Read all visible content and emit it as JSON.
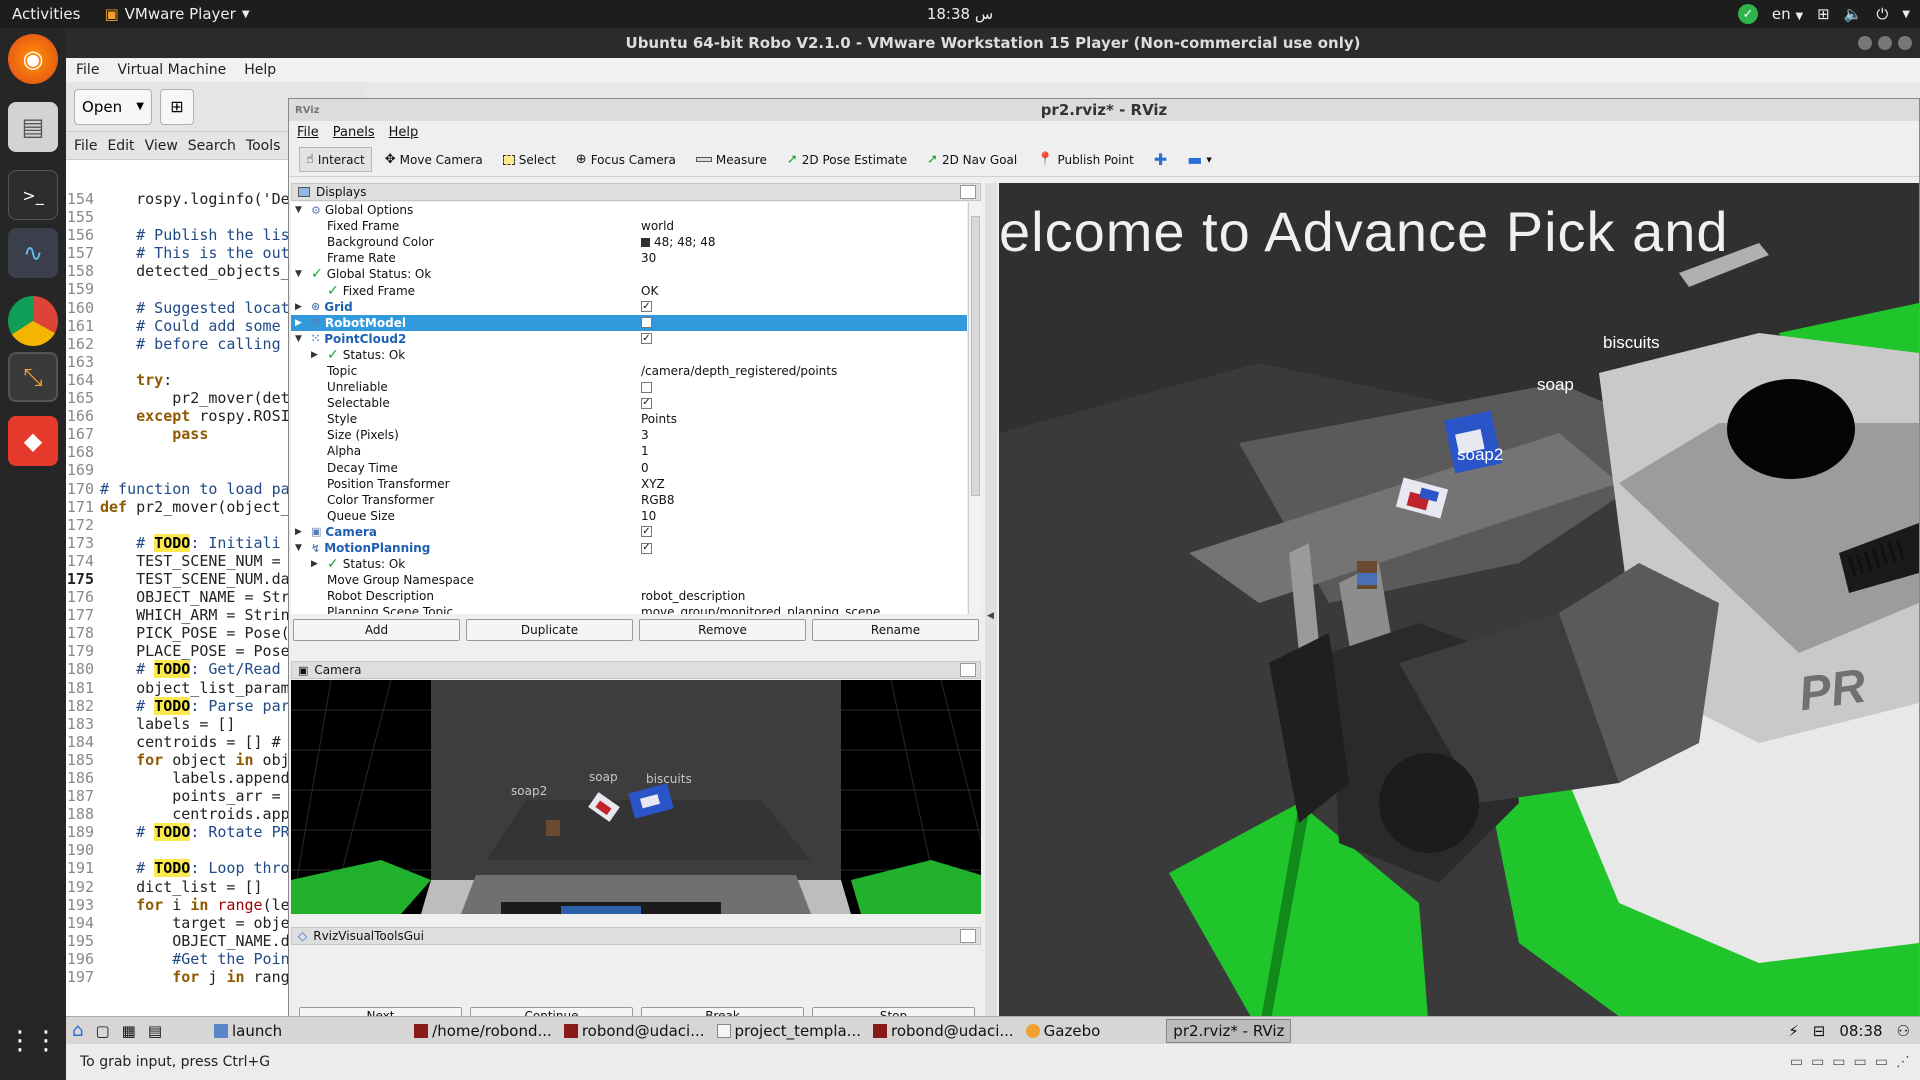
{
  "topbar": {
    "activities": "Activities",
    "app_name": "VMware Player",
    "clock": "18:38 س",
    "lang": "en"
  },
  "vmware": {
    "title": "Ubuntu 64-bit Robo V2.1.0 - VMware Workstation 15 Player (Non-commercial use only)",
    "menu": [
      "File",
      "Virtual Machine",
      "Help"
    ],
    "status": "To grab input, press Ctrl+G"
  },
  "gedit": {
    "open_label": "Open",
    "menu": [
      "File",
      "Edit",
      "View",
      "Search",
      "Tools"
    ],
    "lines": [
      {
        "n": "154",
        "t": "    rospy.loginfo('De"
      },
      {
        "n": "155",
        "t": ""
      },
      {
        "n": "156",
        "t": "    # Publish the lis"
      },
      {
        "n": "157",
        "t": "    # This is the out"
      },
      {
        "n": "158",
        "t": "    detected_objects_"
      },
      {
        "n": "159",
        "t": ""
      },
      {
        "n": "160",
        "t": "    # Suggested locat"
      },
      {
        "n": "161",
        "t": "    # Could add some"
      },
      {
        "n": "162",
        "t": "    # before calling"
      },
      {
        "n": "163",
        "t": ""
      },
      {
        "n": "164",
        "t": "    try:"
      },
      {
        "n": "165",
        "t": "        pr2_mover(det"
      },
      {
        "n": "166",
        "t": "    except rospy.ROSI"
      },
      {
        "n": "167",
        "t": "        pass"
      },
      {
        "n": "168",
        "t": ""
      },
      {
        "n": "169",
        "t": ""
      },
      {
        "n": "170",
        "t": "# function to load pa"
      },
      {
        "n": "171",
        "t": "def pr2_mover(object_"
      },
      {
        "n": "172",
        "t": ""
      },
      {
        "n": "173",
        "t": "    # TODO: Initiali"
      },
      {
        "n": "174",
        "t": "    TEST_SCENE_NUM ="
      },
      {
        "n": "175",
        "t": "    TEST_SCENE_NUM.da"
      },
      {
        "n": "176",
        "t": "    OBJECT_NAME = Str"
      },
      {
        "n": "177",
        "t": "    WHICH_ARM = Strin"
      },
      {
        "n": "178",
        "t": "    PICK_POSE = Pose("
      },
      {
        "n": "179",
        "t": "    PLACE_POSE = Pose"
      },
      {
        "n": "180",
        "t": "    # TODO: Get/Read"
      },
      {
        "n": "181",
        "t": "    object_list_param"
      },
      {
        "n": "182",
        "t": "    # TODO: Parse par"
      },
      {
        "n": "183",
        "t": "    labels = []"
      },
      {
        "n": "184",
        "t": "    centroids = [] #"
      },
      {
        "n": "185",
        "t": "    for object in obj"
      },
      {
        "n": "186",
        "t": "        labels.append"
      },
      {
        "n": "187",
        "t": "        points_arr ="
      },
      {
        "n": "188",
        "t": "        centroids.app"
      },
      {
        "n": "189",
        "t": "    # TODO: Rotate PR"
      },
      {
        "n": "190",
        "t": ""
      },
      {
        "n": "191",
        "t": "    # TODO: Loop thro"
      },
      {
        "n": "192",
        "t": "    dict_list = []"
      },
      {
        "n": "193",
        "t": "    for i in range(le"
      },
      {
        "n": "194",
        "t": "        target = obje"
      },
      {
        "n": "195",
        "t": "        OBJECT_NAME.d"
      },
      {
        "n": "196",
        "t": "        #Get the Poin"
      },
      {
        "n": "197",
        "t": "        for j in rang"
      }
    ]
  },
  "rviz": {
    "title": "pr2.rviz* - RViz",
    "menu": [
      "File",
      "Panels",
      "Help"
    ],
    "tools": [
      {
        "label": "Interact",
        "icon": "cursor-icon"
      },
      {
        "label": "Move Camera",
        "icon": "move-camera-icon"
      },
      {
        "label": "Select",
        "icon": "select-icon"
      },
      {
        "label": "Focus Camera",
        "icon": "focus-icon"
      },
      {
        "label": "Measure",
        "icon": "ruler-icon"
      },
      {
        "label": "2D Pose Estimate",
        "icon": "green-arrow-icon"
      },
      {
        "label": "2D Nav Goal",
        "icon": "green-arrow-icon"
      },
      {
        "label": "Publish Point",
        "icon": "pin-icon"
      }
    ],
    "displays_title": "Displays",
    "tree": [
      {
        "label": "Global Options",
        "value": ""
      },
      {
        "label": "Fixed Frame",
        "value": "world"
      },
      {
        "label": "Background Color",
        "value": "48; 48; 48"
      },
      {
        "label": "Frame Rate",
        "value": "30"
      },
      {
        "label": "Global Status: Ok",
        "value": ""
      },
      {
        "label": "Fixed Frame",
        "value": "OK"
      },
      {
        "label": "Grid",
        "value": ""
      },
      {
        "label": "RobotModel",
        "value": ""
      },
      {
        "label": "PointCloud2",
        "value": ""
      },
      {
        "label": "Status: Ok",
        "value": ""
      },
      {
        "label": "Topic",
        "value": "/camera/depth_registered/points"
      },
      {
        "label": "Unreliable",
        "value": ""
      },
      {
        "label": "Selectable",
        "value": ""
      },
      {
        "label": "Style",
        "value": "Points"
      },
      {
        "label": "Size (Pixels)",
        "value": "3"
      },
      {
        "label": "Alpha",
        "value": "1"
      },
      {
        "label": "Decay Time",
        "value": "0"
      },
      {
        "label": "Position Transformer",
        "value": "XYZ"
      },
      {
        "label": "Color Transformer",
        "value": "RGB8"
      },
      {
        "label": "Queue Size",
        "value": "10"
      },
      {
        "label": "Camera",
        "value": ""
      },
      {
        "label": "MotionPlanning",
        "value": ""
      },
      {
        "label": "Status: Ok",
        "value": ""
      },
      {
        "label": "Move Group Namespace",
        "value": ""
      },
      {
        "label": "Robot Description",
        "value": "robot_description"
      },
      {
        "label": "Planning Scene Topic",
        "value": "move_group/monitored_planning_scene"
      }
    ],
    "buttons": [
      "Add",
      "Duplicate",
      "Remove",
      "Rename"
    ],
    "camera_title": "Camera",
    "camera_labels": [
      "soap2",
      "soap",
      "biscuits"
    ],
    "vtg_title": "RvizVisualToolsGui",
    "vtg_buttons": [
      "Next",
      "Continue",
      "Break",
      "Stop"
    ],
    "view3d": {
      "banner": "elcome  to  Advance  Pick  and",
      "labels": [
        "biscuits",
        "soap",
        "soap2"
      ],
      "robot_text": "PR"
    }
  },
  "taskbar": {
    "items": [
      "launch",
      "/home/robond...",
      "robond@udaci...",
      "project_templa...",
      "robond@udaci...",
      "Gazebo",
      "pr2.rviz* - RViz"
    ],
    "clock": "08:38"
  },
  "colors": {
    "selection": "#3399dd",
    "ok_green": "#1aa32b",
    "view_bg": "#303030",
    "table_green": "#1fc52a"
  }
}
